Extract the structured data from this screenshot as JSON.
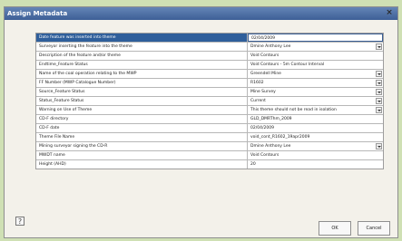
{
  "window": {
    "title": "Assign Metadata",
    "close": "×"
  },
  "table": {
    "rows": [
      {
        "field": "Date feature was inserted into theme",
        "value": "02/04/2009",
        "dropdown": false
      },
      {
        "field": "Surveyor inserting the feature into the theme",
        "value": "Dmine Anthony Lee",
        "dropdown": true
      },
      {
        "field": "Description of the feature and/or theme",
        "value": "Void Contours",
        "dropdown": false
      },
      {
        "field": "Endtime_Feature Status",
        "value": "Void Contours - 5m Contour Interval",
        "dropdown": false
      },
      {
        "field": "Name of the coal operation relating to the MWP",
        "value": "Greendell Mine",
        "dropdown": true
      },
      {
        "field": "FF Number (MWP Catalogue Number)",
        "value": "R1602",
        "dropdown": true
      },
      {
        "field": "Source_Feature Status",
        "value": "Mine Survey",
        "dropdown": true
      },
      {
        "field": "Status_Feature Status",
        "value": "Current",
        "dropdown": true
      },
      {
        "field": "Warning on Use of Theme",
        "value": "This theme should not be read in isolation",
        "dropdown": true
      },
      {
        "field": "CD-F directory",
        "value": "GLD_DMRThm_2009",
        "dropdown": false
      },
      {
        "field": "CD-F date",
        "value": "02/04/2009",
        "dropdown": false
      },
      {
        "field": "Theme File Name",
        "value": "void_cont_R1602_19apr2009",
        "dropdown": false
      },
      {
        "field": "Mining surveyor signing the CD-R",
        "value": "Dmine Anthony Lee",
        "dropdown": true
      },
      {
        "field": "MWDT name",
        "value": "Void Contours",
        "dropdown": false
      },
      {
        "field": "Height (AHD)",
        "value": "20",
        "dropdown": false
      }
    ]
  },
  "buttons": {
    "help": "?",
    "ok": "OK",
    "cancel": "Cancel"
  }
}
